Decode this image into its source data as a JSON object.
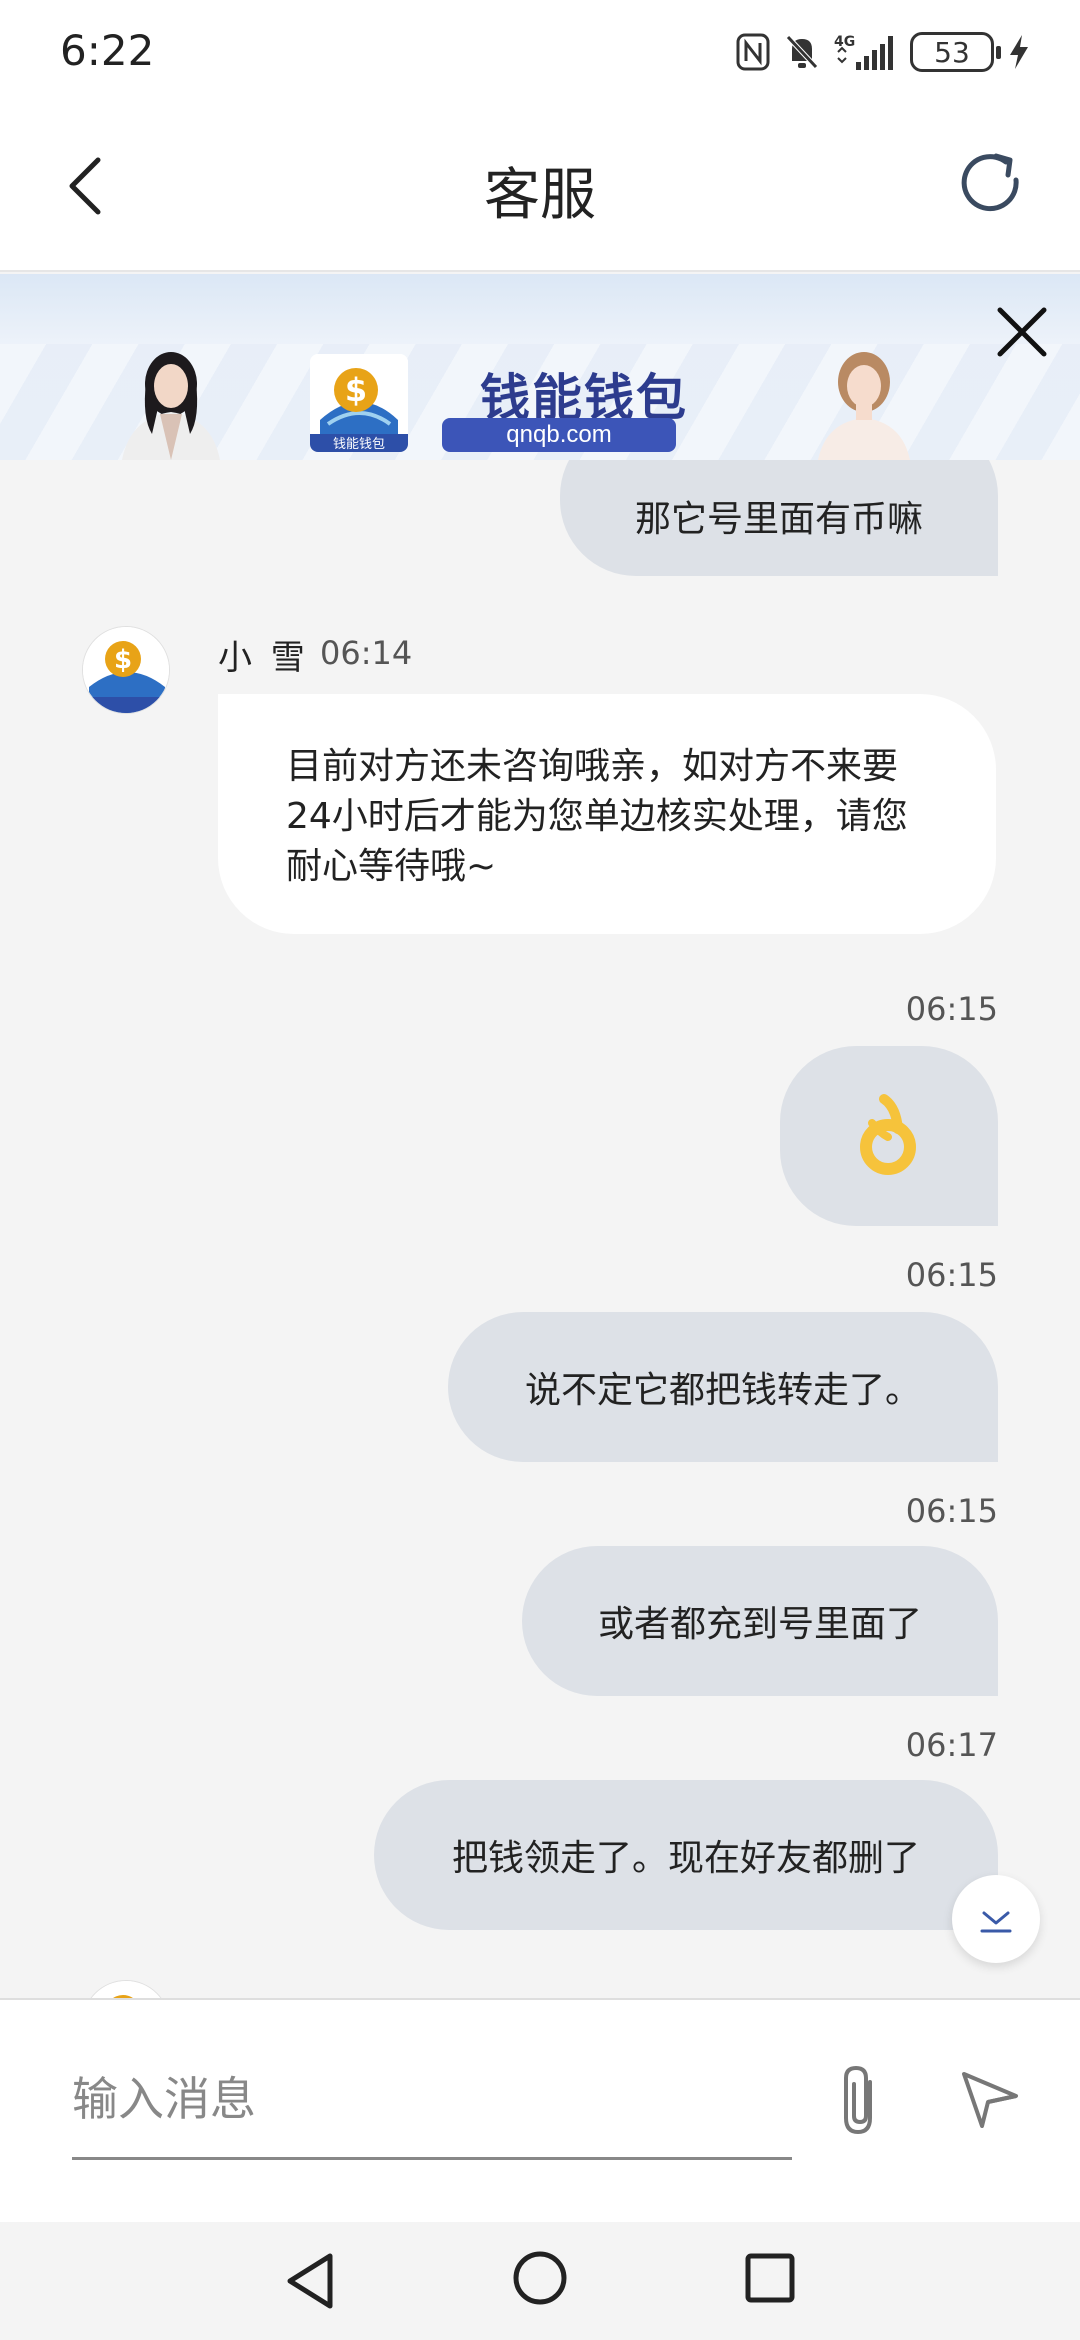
{
  "status_bar": {
    "time": "6:22",
    "network": "4G",
    "battery": "53"
  },
  "header": {
    "title": "客服"
  },
  "banner": {
    "brand_name": "钱能钱包",
    "url": "qnqb.com",
    "logo_caption": "钱能钱包"
  },
  "messages": {
    "m1_text": "那它号里面有币嘛",
    "m2_sender": "小 雪",
    "m2_time": "06:14",
    "m2_text": "目前对方还未咨询哦亲，如对方不来要24小时后才能为您单边核实处理，请您耐心等待哦~",
    "m3_time": "06:15",
    "m3_emoji": "👌",
    "m4_time": "06:15",
    "m4_text": "说不定它都把钱转走了。",
    "m5_time": "06:15",
    "m5_text": "或者都充到号里面了",
    "m6_time": "06:17",
    "m6_text": "把钱领走了。现在好友都删了"
  },
  "input": {
    "placeholder": "输入消息",
    "value": ""
  },
  "colors": {
    "outgoing_bubble": "#dde1e7",
    "incoming_bubble": "#ffffff",
    "background": "#f4f4f4",
    "brand_blue": "#2d3c8e",
    "emoji_yellow": "#f6c33b"
  }
}
